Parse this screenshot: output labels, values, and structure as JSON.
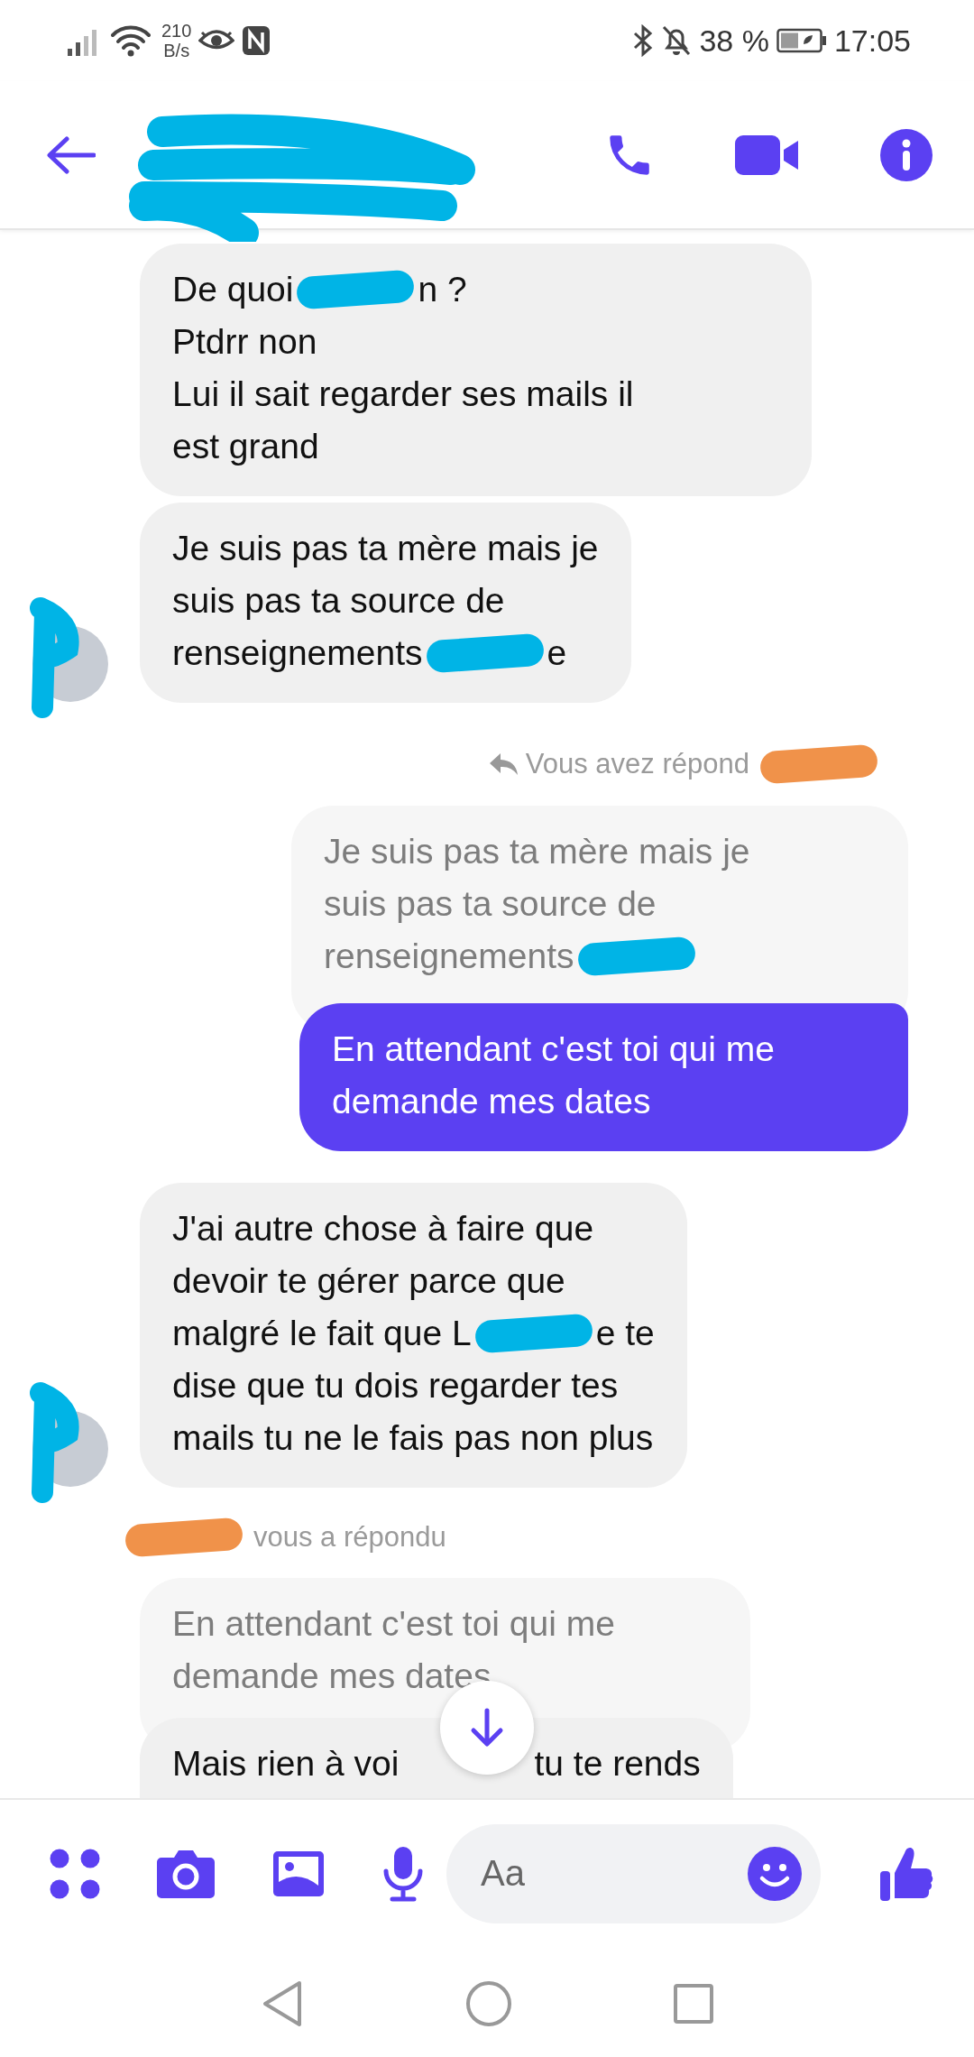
{
  "status_bar": {
    "network_speed": "210",
    "network_unit": "B/s",
    "battery": "38 %",
    "time": "17:05"
  },
  "header": {
    "redaction": {
      "color": "#00b4e6"
    }
  },
  "messages": [
    {
      "kind": "received",
      "lines": [
        [
          {
            "text": "De quoi"
          },
          {
            "kind": "redaction",
            "color": "#00b4e6"
          },
          {
            "text": "n ?"
          }
        ],
        [
          {
            "text": "Ptdrr non"
          }
        ],
        [
          {
            "text": "Lui il sait regarder ses mails il"
          }
        ],
        [
          {
            "text": "est grand"
          }
        ]
      ]
    },
    {
      "kind": "received",
      "avatar": {
        "redaction": {
          "color": "#00b4e6"
        }
      },
      "lines": [
        [
          {
            "text": "Je suis pas ta mère mais je"
          }
        ],
        [
          {
            "text": "suis pas ta source de"
          }
        ],
        [
          {
            "text": "renseignements"
          },
          {
            "kind": "redaction",
            "color": "#00b4e6"
          },
          {
            "text": "e"
          }
        ]
      ]
    },
    {
      "kind": "reply_note",
      "mine": true,
      "reply_icon": true,
      "parts": [
        {
          "text": "Vous avez répond"
        },
        {
          "kind": "redaction",
          "color": "#f0924a"
        }
      ]
    },
    {
      "kind": "quote",
      "mine": true,
      "lines": [
        [
          {
            "text": "Je suis pas ta mère mais je"
          }
        ],
        [
          {
            "text": "suis pas ta source de"
          }
        ],
        [
          {
            "text": "renseignements"
          },
          {
            "kind": "redaction",
            "color": "#00b4e6"
          }
        ]
      ]
    },
    {
      "kind": "sent",
      "lines": [
        [
          {
            "text": "En attendant c'est toi qui me"
          }
        ],
        [
          {
            "text": "demande mes dates"
          }
        ]
      ]
    },
    {
      "kind": "received",
      "avatar": {
        "redaction": {
          "color": "#00b4e6"
        }
      },
      "lines": [
        [
          {
            "text": "J'ai autre chose à faire que"
          }
        ],
        [
          {
            "text": "devoir te gérer parce que"
          }
        ],
        [
          {
            "text": "malgré le fait que L"
          },
          {
            "kind": "redaction",
            "color": "#00b4e6"
          },
          {
            "text": "e te"
          }
        ],
        [
          {
            "text": "dise que tu dois regarder tes"
          }
        ],
        [
          {
            "text": "mails tu ne le fais pas non plus"
          }
        ]
      ]
    },
    {
      "kind": "reply_note",
      "mine": false,
      "parts": [
        {
          "kind": "redaction",
          "color": "#f0924a"
        },
        {
          "text": "vous a répondu"
        }
      ]
    },
    {
      "kind": "quote",
      "mine": false,
      "lines": [
        [
          {
            "text": "En attendant c'est toi qui me"
          }
        ],
        [
          {
            "text": "demande mes dates"
          }
        ]
      ]
    },
    {
      "kind": "received",
      "cut": true,
      "lines": [
        [
          {
            "text": "Mais rien à voi"
          },
          {
            "kind": "gap"
          },
          {
            "text": "tu te rends"
          }
        ]
      ]
    }
  ],
  "composer": {
    "placeholder": "Aa"
  }
}
